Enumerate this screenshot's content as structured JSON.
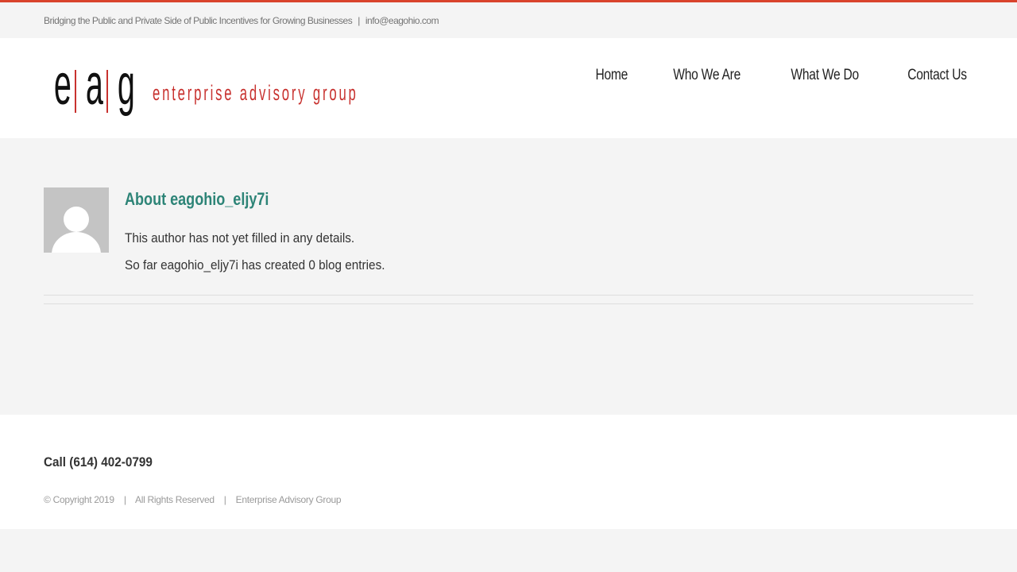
{
  "topbar": {
    "tagline": "Bridging the Public and Private Side of Public Incentives for Growing Businesses",
    "separator": "|",
    "email": "info@eagohio.com"
  },
  "logo": {
    "letters": [
      "e",
      "a",
      "g"
    ],
    "text": "enterprise advisory group"
  },
  "nav": [
    {
      "label": "Home"
    },
    {
      "label": "Who We Are"
    },
    {
      "label": "What We Do"
    },
    {
      "label": "Contact Us"
    }
  ],
  "author": {
    "title": "About eagohio_eljy7i",
    "description": "This author has not yet filled in any details.",
    "entries": "So far eagohio_eljy7i has created 0 blog entries."
  },
  "footer": {
    "call": "Call (614) 402-0799",
    "copyright": "© Copyright 2019",
    "sep": "|",
    "rights": "All Rights Reserved",
    "company": "Enterprise Advisory Group"
  },
  "colors": {
    "accent": "#d9432c",
    "brand_red": "#c8322f",
    "heading_teal": "#2d8477"
  }
}
